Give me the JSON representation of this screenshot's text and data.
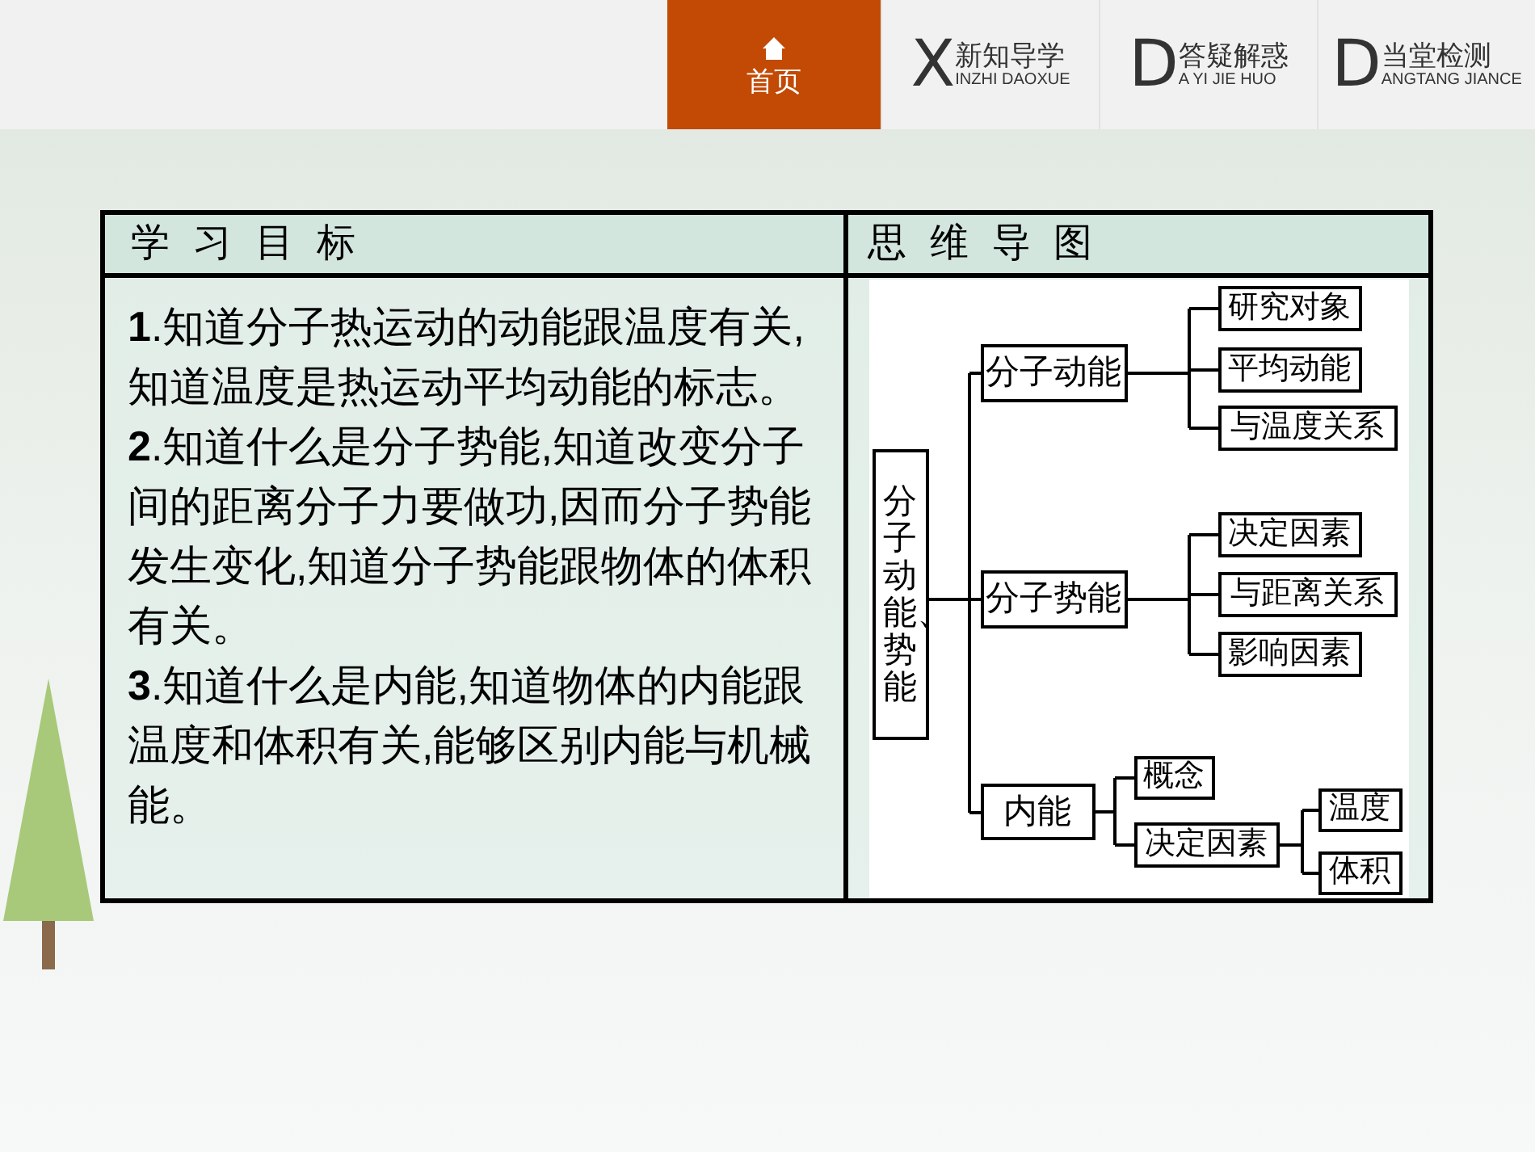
{
  "nav": [
    {
      "kind": "home",
      "label": "首页",
      "selected": true
    },
    {
      "kind": "section",
      "letter": "X",
      "title": "新知导学",
      "subtitle": "INZHI DAOXUE",
      "selected": false
    },
    {
      "kind": "section",
      "letter": "D",
      "title": "答疑解惑",
      "subtitle": "A YI JIE HUO",
      "selected": false
    },
    {
      "kind": "section",
      "letter": "D",
      "title": "当堂检测",
      "subtitle": "ANGTANG JIANCE",
      "selected": false
    }
  ],
  "table": {
    "columns": [
      "学习目标",
      "思维导图"
    ],
    "goals": [
      "**1**.知道分子热运动的动能跟温度有关,知道温度是热运动平均动能的标志。",
      "**2**.知道什么是分子势能,知道改变分子间的距离分子力要做功,因而分子势能发生变化,知道分子势能跟物体的体积有关。",
      "**3**.知道什么是内能,知道物体的内能跟温度和体积有关,能够区别内能与机械能。"
    ],
    "mind_map": {
      "label": "分子动能、势能",
      "children": [
        {
          "label": "分子动能",
          "children": [
            {
              "label": "研究对象"
            },
            {
              "label": "平均动能"
            },
            {
              "label": "与温度关系"
            }
          ]
        },
        {
          "label": "分子势能",
          "children": [
            {
              "label": "决定因素"
            },
            {
              "label": "与距离关系"
            },
            {
              "label": "影响因素"
            }
          ]
        },
        {
          "label": "内能",
          "children": [
            {
              "label": "概念"
            },
            {
              "label": "决定因素",
              "children": [
                {
                  "label": "温度"
                },
                {
                  "label": "体积"
                }
              ]
            }
          ]
        }
      ]
    }
  }
}
